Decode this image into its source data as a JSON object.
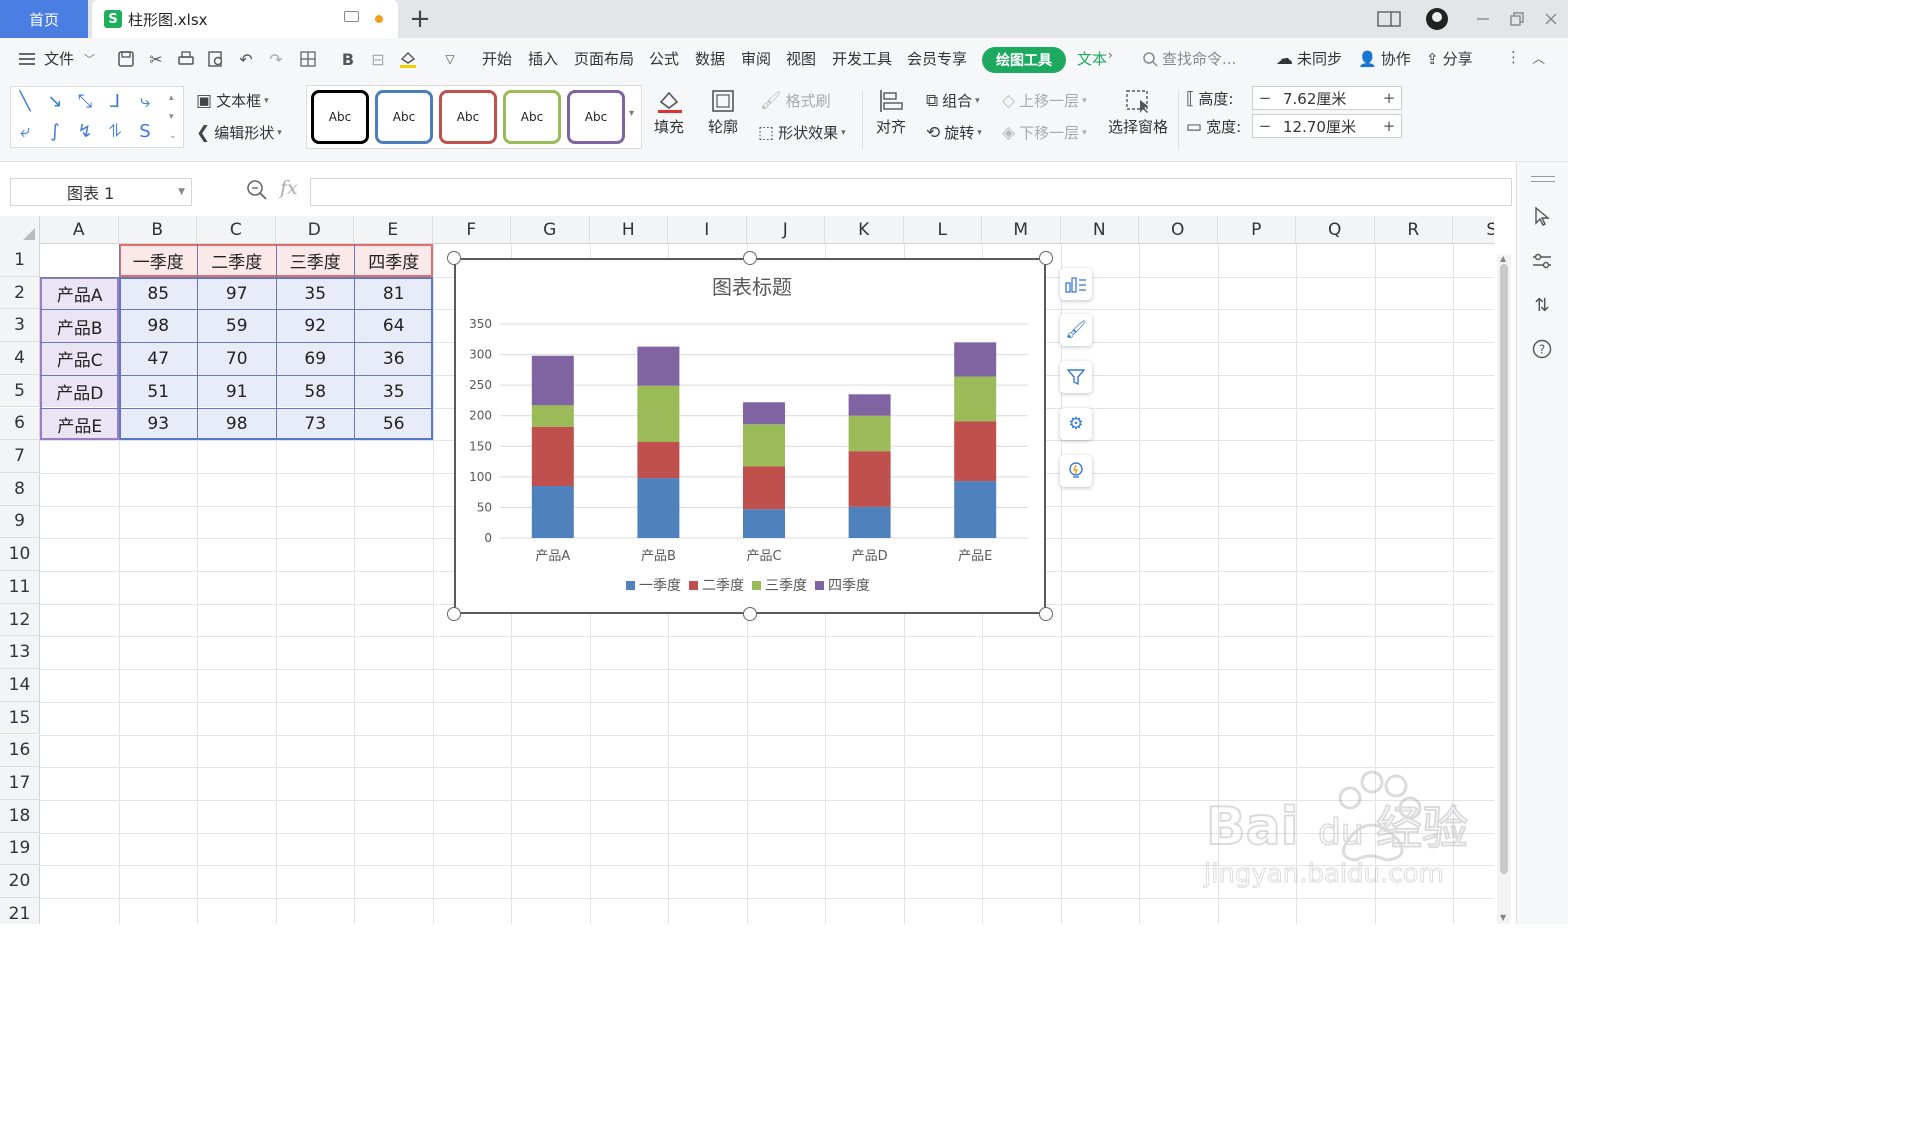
{
  "titlebar": {
    "home_tab": "首页",
    "file_name": "柱形图.xlsx",
    "new_tab": "+"
  },
  "menubar": {
    "file_menu": "文件",
    "tabs": [
      "开始",
      "插入",
      "页面布局",
      "公式",
      "数据",
      "审阅",
      "视图",
      "开发工具",
      "会员专享"
    ],
    "active_tab": "绘图工具",
    "text_tab": "文本",
    "search_placeholder": "查找命令...",
    "sync": "未同步",
    "collab": "协作",
    "share": "分享"
  },
  "ribbon": {
    "textbox": "文本框",
    "edit_shape": "编辑形状",
    "abc_styles": [
      {
        "label": "Abc",
        "color": "#000000"
      },
      {
        "label": "Abc",
        "color": "#4a7ebb"
      },
      {
        "label": "Abc",
        "color": "#c0504d"
      },
      {
        "label": "Abc",
        "color": "#9bbb59"
      },
      {
        "label": "Abc",
        "color": "#8064a2"
      }
    ],
    "fill": "填充",
    "outline": "轮廓",
    "format_painter": "格式刷",
    "shape_effects": "形状效果",
    "align": "对齐",
    "group": "组合",
    "rotate": "旋转",
    "bring_forward": "上移一层",
    "send_backward": "下移一层",
    "selection_pane": "选择窗格",
    "height_label": "高度:",
    "height_value": "7.62厘米",
    "width_label": "宽度:",
    "width_value": "12.70厘米",
    "minus": "−",
    "plus": "+"
  },
  "formula_bar": {
    "name_box": "图表 1",
    "fx": "fx",
    "content": ""
  },
  "sheet": {
    "columns": [
      "A",
      "B",
      "C",
      "D",
      "E",
      "F",
      "G",
      "H",
      "I",
      "J",
      "K",
      "L",
      "M",
      "N",
      "O",
      "P",
      "Q",
      "R",
      "S"
    ],
    "rows": [
      "1",
      "2",
      "3",
      "4",
      "5",
      "6",
      "7",
      "8",
      "9",
      "10",
      "11",
      "12",
      "13",
      "14",
      "15",
      "16",
      "17",
      "18",
      "19",
      "20",
      "21"
    ],
    "header_row": [
      "",
      "一季度",
      "二季度",
      "三季度",
      "四季度"
    ],
    "data_rows": [
      [
        "产品A",
        "85",
        "97",
        "35",
        "81"
      ],
      [
        "产品B",
        "98",
        "59",
        "92",
        "64"
      ],
      [
        "产品C",
        "47",
        "70",
        "69",
        "36"
      ],
      [
        "产品D",
        "51",
        "91",
        "58",
        "35"
      ],
      [
        "产品E",
        "93",
        "98",
        "73",
        "56"
      ]
    ]
  },
  "chart_data": {
    "type": "bar",
    "stacked": true,
    "title": "图表标题",
    "categories": [
      "产品A",
      "产品B",
      "产品C",
      "产品D",
      "产品E"
    ],
    "series": [
      {
        "name": "一季度",
        "values": [
          85,
          98,
          47,
          51,
          93
        ],
        "color": "#4f81bd"
      },
      {
        "name": "二季度",
        "values": [
          97,
          59,
          70,
          91,
          98
        ],
        "color": "#c0504d"
      },
      {
        "name": "三季度",
        "values": [
          35,
          92,
          69,
          58,
          73
        ],
        "color": "#9bbb59"
      },
      {
        "name": "四季度",
        "values": [
          81,
          64,
          36,
          35,
          56
        ],
        "color": "#8064a2"
      }
    ],
    "yticks": [
      0,
      50,
      100,
      150,
      200,
      250,
      300,
      350
    ],
    "ylim": [
      0,
      350
    ],
    "grid": true,
    "legend": "bottom"
  },
  "colors": {
    "accent_blue": "#4a7ee3",
    "draw_tools_green": "#1ea960"
  },
  "watermark": {
    "brand": "Baidu经验",
    "url": "jingyan.baidu.com"
  }
}
